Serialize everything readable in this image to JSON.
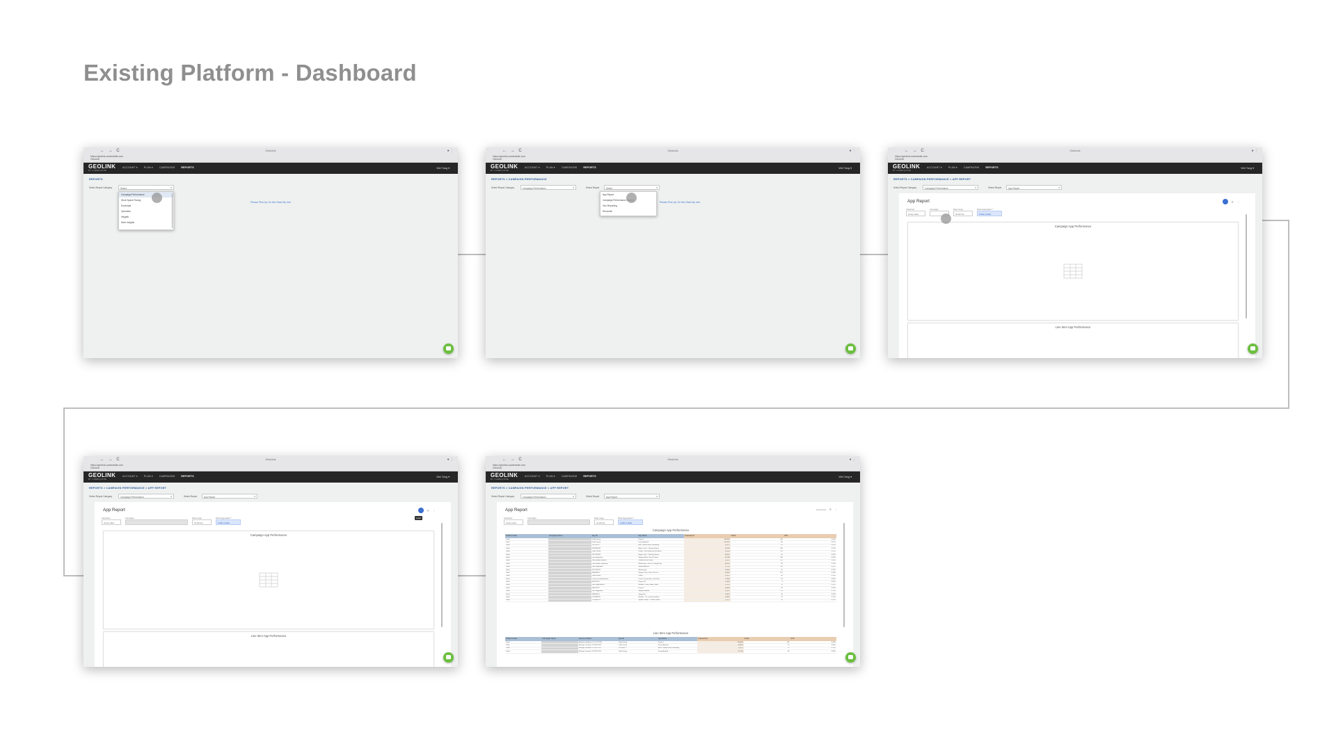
{
  "page": {
    "title": "Existing Platform - Dashboard"
  },
  "browser": {
    "tab_title": "GeoLink",
    "url": "https://geolink.contentsite.com",
    "url_sub": "GeoLink",
    "controls": "← → C",
    "menu_dots": "● ⋮"
  },
  "app": {
    "logo": "GEOLINK",
    "logo_sub": "BY CUEBIQ/ONE",
    "nav": [
      "ACCOUNT ▾",
      "PLAN ▾",
      "CAMPAIGNS",
      "REPORTS"
    ],
    "user": "Wei Tang ▾"
  },
  "screens": {
    "s1": {
      "breadcrumb": "REPORTS",
      "category_label": "Select Report Category",
      "category_value": "Select",
      "dropdown": [
        "Campaign Performance",
        "Store Space Pacing",
        "Download",
        "Operation",
        "Insights",
        "More Insights"
      ],
      "hint": "Please Pick Up On Bot Start My Info"
    },
    "s2": {
      "breadcrumb": "REPORTS  >  CAMPAIGN PERFORMANCE",
      "category_label": "Select Report Category",
      "category_value": "Campaign Performance",
      "report_label": "Select Report",
      "report_value": "Select",
      "dropdown": [
        "App Report",
        "Campaign Performance Report",
        "Geo Reporting",
        "Reconcile"
      ],
      "hint": "Please Pick Up On Bot Start My Info"
    },
    "s3": {
      "breadcrumb": "REPORTS  >  CAMPAIGN PERFORMANCE  >  APP REPORT",
      "category_label": "Select Report Category",
      "category_value": "Campaign Performance",
      "report_label": "Select Report",
      "report_value": "App Report"
    },
    "s4": {
      "breadcrumb": "REPORTS  >  CAMPAIGN PERFORMANCE  >  APP REPORT",
      "category_label": "Select Report Category",
      "category_value": "Campaign Performance",
      "report_label": "Select Report",
      "report_value": "App Report",
      "tooltip": "Load"
    },
    "s5": {
      "breadcrumb": "REPORTS  >  CAMPAIGN PERFORMANCE  >  APP REPORT",
      "category_label": "Select Report Category",
      "category_value": "Campaign Performance",
      "report_label": "Select Report",
      "report_value": "App Report",
      "export_label": "Download"
    }
  },
  "report": {
    "title": "App Report",
    "filters": {
      "advertiser_label": "Advertiser",
      "advertiser_value": "Group value",
      "campaign_label": "Campaign",
      "date_label": "Date range",
      "date_value": "24 all time",
      "aggregation_label": "Data Aggregation *",
      "aggregation_value": "Totals to Date"
    },
    "panel1_title": "Campaign App Performance",
    "panel2_title": "Line Item App Performance",
    "icons": {
      "refresh": "⟳",
      "more": "⋮"
    }
  },
  "table1": {
    "columns": [
      "Totals to Date",
      "Campaign Name",
      "App ID",
      "App Name",
      "Impressions",
      "Clicks",
      "CTR"
    ],
    "rows": [
      [
        "Totals",
        "",
        "Vudu Disney",
        "Funny 1",
        "164,933",
        "136",
        "0.08%"
      ],
      [
        "Totals",
        "",
        "Vudu Disney",
        "Funny, Android",
        "113,178",
        "83",
        "0.07%"
      ],
      [
        "Totals",
        "",
        "297564115",
        "Bear: Stream Music Streaming",
        "68,678",
        "43",
        "0.06%"
      ],
      [
        "Totals",
        "",
        "1287861045",
        "Bingo Crush - Calming Games",
        "57,903",
        "158",
        "0.27%"
      ],
      [
        "Totals",
        "",
        "Vudu Disney",
        "Funny - Dark Native gift and Ideas",
        "49,698",
        "124",
        "0.25%"
      ],
      [
        "Totals",
        "",
        "1357135246",
        "Bingo Crush - Coloring Games",
        "48,310",
        "20",
        "0.04%"
      ],
      [
        "Totals",
        "",
        "com.Suggestion",
        "Tapped: Music Chat & Dating",
        "31,299",
        "108",
        "0.35%"
      ],
      [
        "Totals",
        "",
        "com.pandora.android",
        "Pandora Music Radio",
        "26,824",
        "178",
        "0.66%"
      ],
      [
        "Totals",
        "",
        "com.pandora.andomem",
        "Wordscapes - Earn on Google Pay",
        "26,122",
        "26",
        "0.10%"
      ],
      [
        "Totals",
        "",
        "com.Suggestion",
        "Tapped Android",
        "23,769",
        "144",
        "0.61%"
      ],
      [
        "Totals",
        "",
        "1251743720",
        "Wordscapes",
        "22,623",
        "47",
        "0.21%"
      ],
      [
        "Totals",
        "",
        "296846125",
        "Tapped: Chat, Chat & Go Live",
        "20,687",
        "101",
        "0.49%"
      ],
      [
        "Totals",
        "",
        "Vudu Disney",
        "Funny",
        "18,523",
        "30",
        "0.16%"
      ],
      [
        "Totals",
        "",
        "com.lovoo.android.lovoo",
        "Lovoo: Communities and Chats",
        "17,864",
        "16",
        "0.09%"
      ],
      [
        "Totals",
        "",
        "325871107",
        "Funny, 2/8",
        "17,363",
        "3",
        "0.02%"
      ],
      [
        "Totals",
        "",
        "com.Suggestion.ai",
        "Beatbits: Color & Bible Planet",
        "16,911",
        "11",
        "0.07%"
      ],
      [
        "Totals",
        "",
        "325871107",
        "Funny 2",
        "15,593",
        "16",
        "0.10%"
      ],
      [
        "Totals",
        "",
        "com.Suggestion",
        "Tapped: Android",
        "14,810",
        "113",
        "0.76%"
      ],
      [
        "Totals",
        "",
        "296846125",
        "Tapped Ios",
        "13,675",
        "44",
        "0.32%"
      ],
      [
        "Totals",
        "",
        "1173843378",
        "Beatbits - On Long Sound Best",
        "12,837",
        "14",
        "0.11%"
      ],
      [
        "Totals",
        "",
        "1734844870",
        "Jigsaw Puzzles - Puzzle Games",
        "11,673",
        "26",
        "0.22%"
      ]
    ]
  },
  "table2": {
    "columns": [
      "Totals to Date",
      "Campaign Name",
      "Line Item Name",
      "App ID",
      "App Name",
      "Impressions",
      "Clicks",
      "CTR"
    ],
    "rows": [
      [
        "Totals",
        "",
        "Amplience Audience FY 07/17/701",
        "Vudu Disney",
        "Funny 1",
        "204,806",
        "162",
        "0.08%"
      ],
      [
        "Totals",
        "",
        "Retarget Locations 2/1 09/17/701",
        "Vudu Disney",
        "Funny, Android",
        "80,976",
        "72",
        "0.09%"
      ],
      [
        "Totals",
        "",
        "Retarget Locations 2/1 09/17/701",
        "297564115",
        "Bear - Simple Music Streaming",
        "50,114",
        "76",
        "0.15%"
      ],
      [
        "Totals",
        "",
        "Retarget Locations 2/1 09/17/701",
        "Vudu Disney",
        "Funny Android",
        "47,726",
        "36",
        "0.08%"
      ]
    ]
  }
}
